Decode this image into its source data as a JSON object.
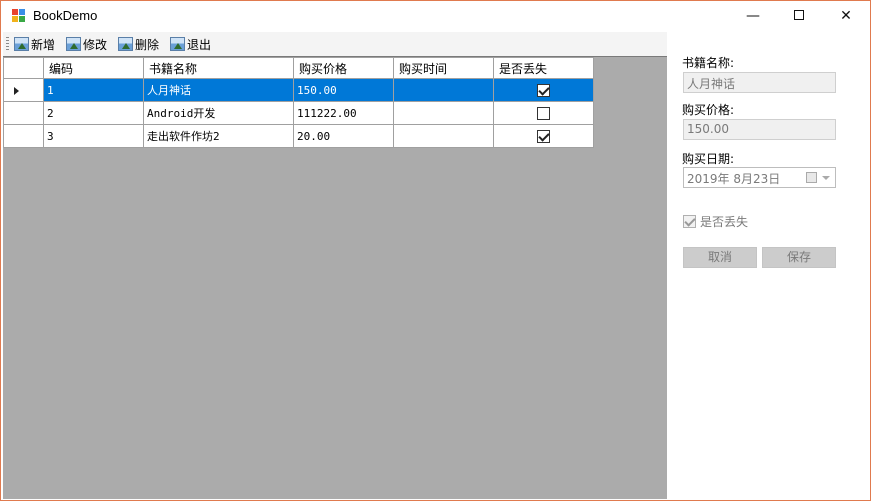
{
  "window": {
    "title": "BookDemo"
  },
  "toolbar": {
    "buttons": [
      {
        "label": "新增"
      },
      {
        "label": "修改"
      },
      {
        "label": "删除"
      },
      {
        "label": "退出"
      }
    ]
  },
  "grid": {
    "columns": [
      "编码",
      "书籍名称",
      "购买价格",
      "购买时间",
      "是否丢失"
    ],
    "rows": [
      {
        "id": "1",
        "name": "人月神话",
        "price": "150.00",
        "date": "",
        "lost": true,
        "selected": true
      },
      {
        "id": "2",
        "name": "Android开发",
        "price": "111222.00",
        "date": "",
        "lost": false,
        "selected": false
      },
      {
        "id": "3",
        "name": "走出软件作坊2",
        "price": "20.00",
        "date": "",
        "lost": true,
        "selected": false
      }
    ]
  },
  "form": {
    "name_label": "书籍名称:",
    "name_value": "人月神话",
    "price_label": "购买价格:",
    "price_value": "150.00",
    "date_label": "购买日期:",
    "date_value": "2019年  8月23日",
    "lost_label": "是否丢失",
    "lost_checked": true,
    "cancel_label": "取消",
    "save_label": "保存"
  },
  "colors": {
    "selection": "#0078d7",
    "grid_background": "#ababab",
    "window_border": "#e07a4e"
  }
}
